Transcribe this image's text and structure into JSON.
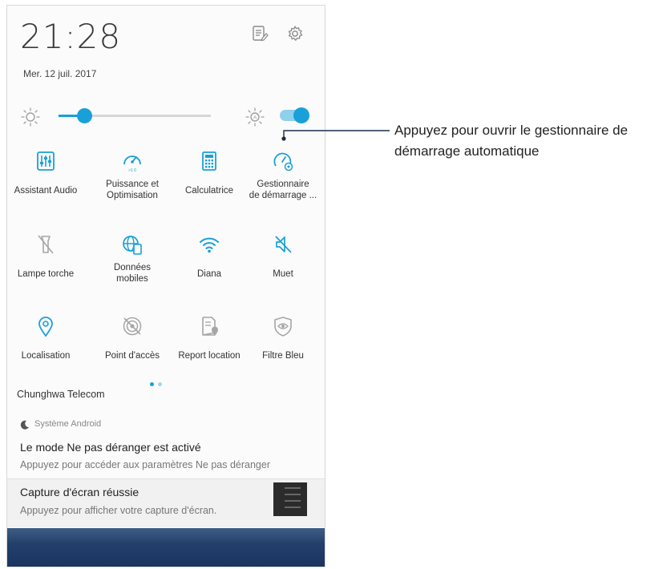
{
  "status": {
    "time": "21:28",
    "date": "Mer. 12 juil. 2017"
  },
  "colors": {
    "accent": "#1aa0d8",
    "icon_gray": "#9a9a9a",
    "text": "#333333",
    "dark_bar": "#23406b"
  },
  "brightness": {
    "level": 0.17
  },
  "tiles": [
    {
      "label": "Assistant Audio",
      "icon": "audio-equalizer-icon",
      "active": true
    },
    {
      "label": "Puissance et\nOptimisation",
      "icon": "speedometer-icon",
      "active": true
    },
    {
      "label": "Calculatrice",
      "icon": "calculator-icon",
      "active": true
    },
    {
      "label": "Gestionnaire\nde démarrage ...",
      "icon": "autostart-manager-icon",
      "active": true
    },
    {
      "label": "Lampe torche",
      "icon": "flashlight-icon",
      "active": false
    },
    {
      "label": "Données\nmobiles",
      "icon": "mobile-data-icon",
      "active": true
    },
    {
      "label": "Diana",
      "icon": "wifi-icon",
      "active": true
    },
    {
      "label": "Muet",
      "icon": "mute-icon",
      "active": true
    },
    {
      "label": "Localisation",
      "icon": "location-icon",
      "active": true
    },
    {
      "label": "Point d'accès",
      "icon": "hotspot-icon",
      "active": false
    },
    {
      "label": "Report location",
      "icon": "report-location-icon",
      "active": false
    },
    {
      "label": "Filtre Bleu",
      "icon": "blue-filter-icon",
      "active": false
    }
  ],
  "operator": "Chunghwa Telecom",
  "notifications": [
    {
      "app": "Système Android",
      "title": "Le mode Ne pas déranger est activé",
      "text": "Appuyez pour accéder aux paramètres Ne pas déranger"
    },
    {
      "app": "",
      "title": "Capture d'écran réussie",
      "text": "Appuyez pour afficher votre capture d'écran."
    }
  ],
  "callout": {
    "line1": "Appuyez pour ouvrir le gestionnaire de",
    "line2": "démarrage automatique"
  }
}
